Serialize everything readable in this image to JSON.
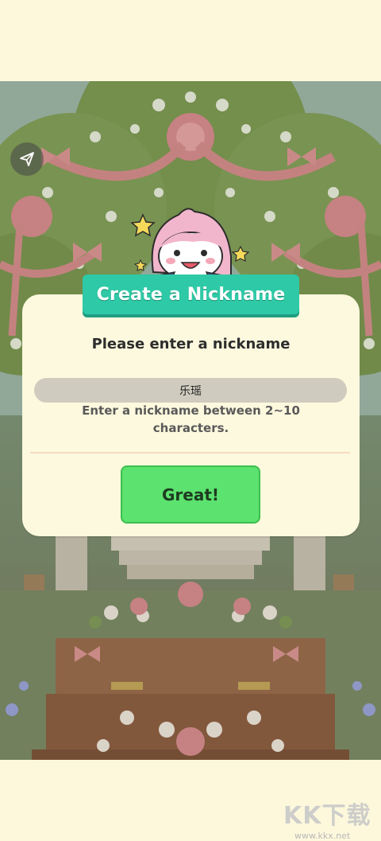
{
  "dialog": {
    "title": "Create a Nickname",
    "prompt": "Please enter a nickname",
    "input_value": "乐瑶",
    "hint": "Enter a nickname between 2~10 characters.",
    "confirm_label": "Great!"
  },
  "toolbar": {
    "share_icon": "share-arrow-icon"
  },
  "watermark": {
    "text": "KK下载",
    "url": "www.kkx.net"
  },
  "colors": {
    "background": "#fdf8dc",
    "banner": "#2ec9a6",
    "confirm": "#5ce26f",
    "input": "#cfccbf"
  }
}
